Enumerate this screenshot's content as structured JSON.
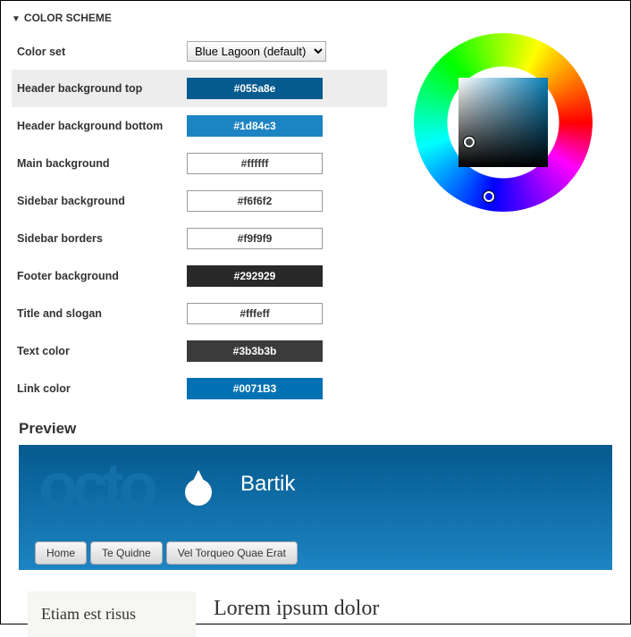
{
  "section_title": "COLOR SCHEME",
  "preset": {
    "label": "Color set",
    "selected": "Blue Lagoon (default)"
  },
  "colors": [
    {
      "label": "Header background top",
      "value": "#055a8e",
      "bg": "#055a8e",
      "fg": "#ffffff",
      "selected": true
    },
    {
      "label": "Header background bottom",
      "value": "#1d84c3",
      "bg": "#1d84c3",
      "fg": "#ffffff",
      "selected": false
    },
    {
      "label": "Main background",
      "value": "#ffffff",
      "bg": "#ffffff",
      "fg": "#333333",
      "selected": false
    },
    {
      "label": "Sidebar background",
      "value": "#f6f6f2",
      "bg": "#ffffff",
      "fg": "#333333",
      "selected": false
    },
    {
      "label": "Sidebar borders",
      "value": "#f9f9f9",
      "bg": "#ffffff",
      "fg": "#333333",
      "selected": false
    },
    {
      "label": "Footer background",
      "value": "#292929",
      "bg": "#292929",
      "fg": "#ffffff",
      "selected": false
    },
    {
      "label": "Title and slogan",
      "value": "#fffeff",
      "bg": "#ffffff",
      "fg": "#333333",
      "selected": false
    },
    {
      "label": "Text color",
      "value": "#3b3b3b",
      "bg": "#3b3b3b",
      "fg": "#ffffff",
      "selected": false
    },
    {
      "label": "Link color",
      "value": "#0071B3",
      "bg": "#0071B3",
      "fg": "#ffffff",
      "selected": false
    }
  ],
  "preview": {
    "heading": "Preview",
    "site_name": "Bartik",
    "tabs": [
      "Home",
      "Te Quidne",
      "Vel Torqueo Quae Erat"
    ],
    "sidebar_heading": "Etiam est risus",
    "main_heading": "Lorem ipsum dolor"
  }
}
